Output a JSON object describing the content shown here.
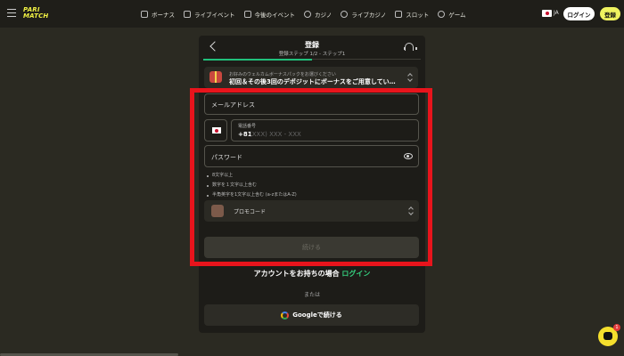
{
  "brand": {
    "logo_line1": "PARI",
    "logo_line2": "MATCH",
    "accent": "#eff25f"
  },
  "nav": [
    {
      "label": "ボーナス",
      "icon": "gift-icon"
    },
    {
      "label": "ライブイベント",
      "icon": "live-icon"
    },
    {
      "label": "今後のイベント",
      "icon": "calendar-icon"
    },
    {
      "label": "カジノ",
      "icon": "casino-icon"
    },
    {
      "label": "ライブカジノ",
      "icon": "live-casino-icon"
    },
    {
      "label": "スロット",
      "icon": "slot-icon"
    },
    {
      "label": "ゲーム",
      "icon": "rocket-icon"
    }
  ],
  "header": {
    "lang": "JA",
    "login": "ログイン",
    "signup": "登録"
  },
  "modal": {
    "title": "登録",
    "subtitle": "登録ステップ 1/2 - ステップ1",
    "progress": 0.5,
    "bonus_label": "お好みのウェルカムボーナスパックをお選びください",
    "bonus_value": "初回＆その後3回のデポジットにボーナスをご用意してい…",
    "email_placeholder": "メールアドレス",
    "phone_label": "電話番号",
    "phone_prefix": "+81",
    "phone_placeholder": "(XXX) XXX - XXX",
    "password_placeholder": "パスワード",
    "rules": [
      "8文字以上",
      "数字を１文字以上含む",
      "半角英字を1文字以上含む (a-zまたはA-Z)"
    ],
    "promo_label": "プロモコード",
    "continue": "続ける",
    "account_text": "アカウントをお持ちの場合",
    "account_login": "ログイン",
    "or": "または",
    "google": "Googleで続ける"
  },
  "chat": {
    "badge": "1"
  }
}
